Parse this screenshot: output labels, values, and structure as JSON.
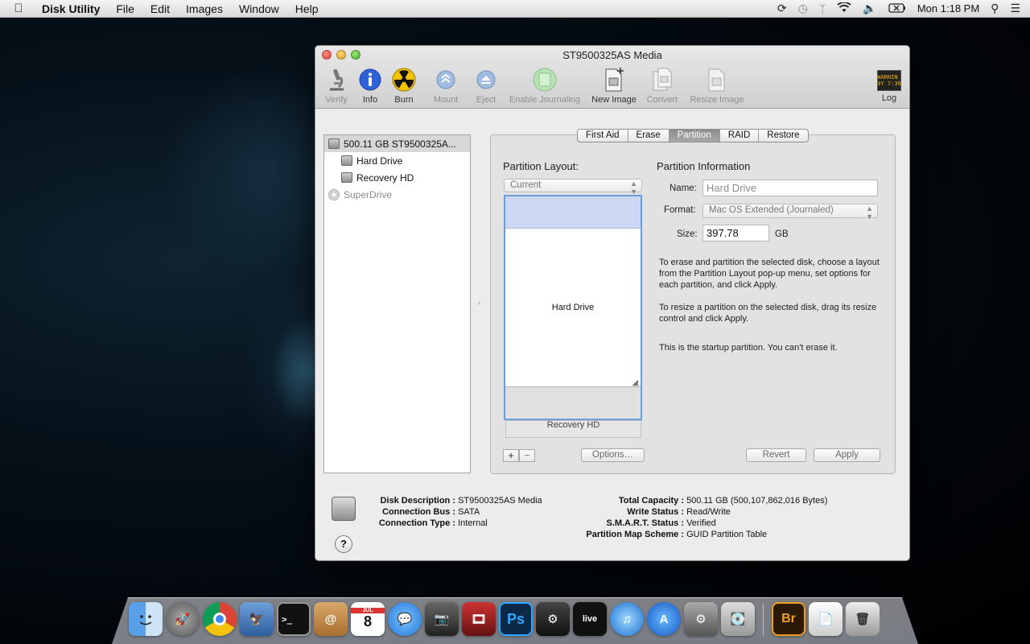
{
  "menubar": {
    "app": "Disk Utility",
    "items": [
      "File",
      "Edit",
      "Images",
      "Window",
      "Help"
    ],
    "clock": "Mon 1:18 PM"
  },
  "window": {
    "title": "ST9500325AS Media",
    "toolbar": {
      "verify": "Verify",
      "info": "Info",
      "burn": "Burn",
      "mount": "Mount",
      "eject": "Eject",
      "enable_journaling": "Enable Journaling",
      "new_image": "New Image",
      "convert": "Convert",
      "resize_image": "Resize Image",
      "log": "Log",
      "log_icon_text": "WARNIN\n9Y 7:36"
    },
    "sidebar": {
      "disk": "500.11 GB ST9500325A...",
      "volumes": [
        "Hard Drive",
        "Recovery HD"
      ],
      "superdrive": "SuperDrive"
    },
    "tabs": [
      "First Aid",
      "Erase",
      "Partition",
      "RAID",
      "Restore"
    ],
    "partition": {
      "layout_label": "Partition Layout:",
      "layout_value": "Current",
      "hard_drive_block": "Hard Drive",
      "recovery_block": "Recovery HD",
      "info_heading": "Partition Information",
      "name_label": "Name:",
      "name_value": "Hard Drive",
      "format_label": "Format:",
      "format_value": "Mac OS Extended (Journaled)",
      "size_label": "Size:",
      "size_value": "397.78",
      "size_unit": "GB",
      "help1": "To erase and partition the selected disk, choose a layout from the Partition Layout pop-up menu, set options for each partition, and click Apply.",
      "help2": "To resize a partition on the selected disk, drag its resize control and click Apply.",
      "help3": "This is the startup partition. You can't erase it.",
      "plus": "+",
      "minus": "−",
      "options": "Options…",
      "revert": "Revert",
      "apply": "Apply"
    },
    "disk_info": {
      "left": [
        {
          "k": "Disk Description :",
          "v": "ST9500325AS Media"
        },
        {
          "k": "Connection Bus :",
          "v": "SATA"
        },
        {
          "k": "Connection Type :",
          "v": "Internal"
        }
      ],
      "right": [
        {
          "k": "Total Capacity :",
          "v": "500.11 GB (500,107,862,016 Bytes)"
        },
        {
          "k": "Write Status :",
          "v": "Read/Write"
        },
        {
          "k": "S.M.A.R.T. Status :",
          "v": "Verified"
        },
        {
          "k": "Partition Map Scheme :",
          "v": "GUID Partition Table"
        }
      ],
      "help": "?"
    }
  },
  "dock": {
    "calendar_month": "JUL",
    "calendar_day": "8",
    "ps": "Ps",
    "br": "Br",
    "live": "live"
  }
}
